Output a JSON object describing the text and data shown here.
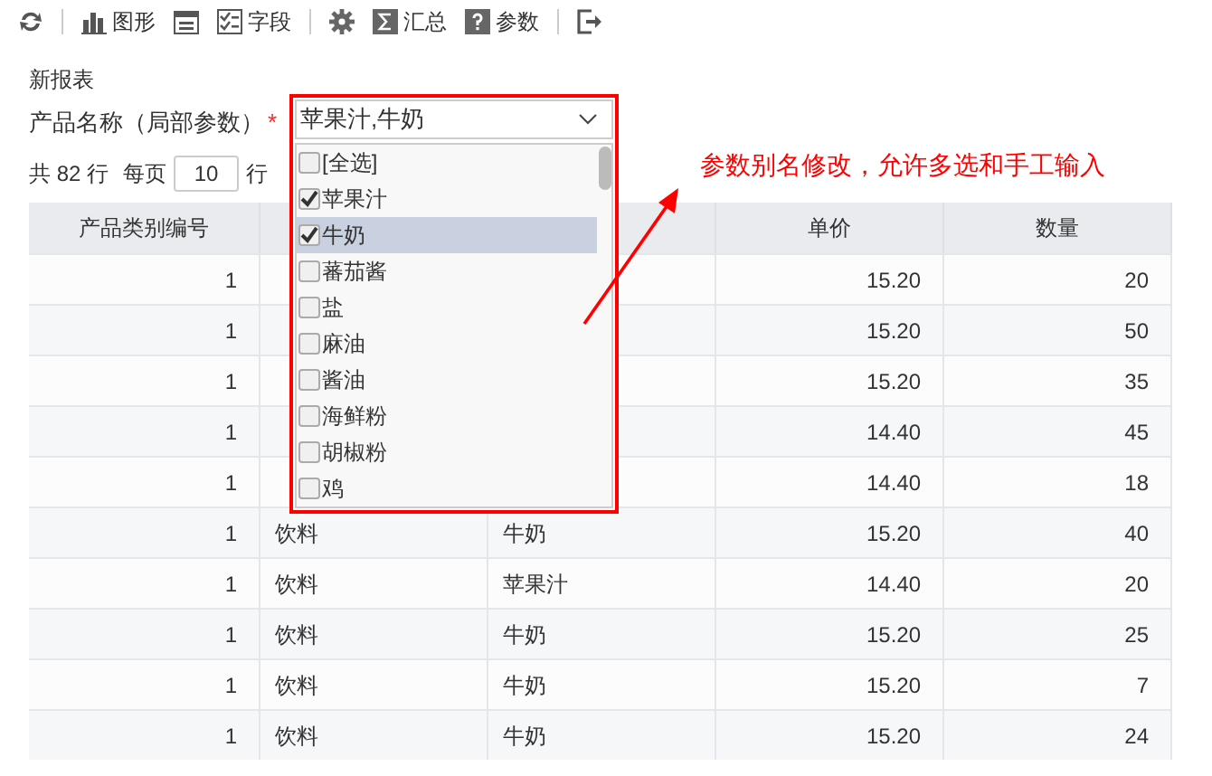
{
  "toolbar": [
    {
      "kind": "refresh"
    },
    {
      "kind": "separator"
    },
    {
      "kind": "chart",
      "label": "图形"
    },
    {
      "kind": "layout"
    },
    {
      "kind": "fields",
      "label": "字段"
    },
    {
      "kind": "separator"
    },
    {
      "kind": "settings"
    },
    {
      "kind": "sum",
      "label": "汇总"
    },
    {
      "kind": "help",
      "label": "参数"
    },
    {
      "kind": "separator"
    },
    {
      "kind": "exit"
    }
  ],
  "report_title": "新报表",
  "parameter": {
    "label": "产品名称（局部参数）",
    "required_mark": "*",
    "value": "苹果汁,牛奶",
    "options": [
      {
        "label": "[全选]",
        "checked": false,
        "selected": false
      },
      {
        "label": "苹果汁",
        "checked": true,
        "selected": false
      },
      {
        "label": "牛奶",
        "checked": true,
        "selected": true
      },
      {
        "label": "蕃茄酱",
        "checked": false,
        "selected": false
      },
      {
        "label": "盐",
        "checked": false,
        "selected": false
      },
      {
        "label": "麻油",
        "checked": false,
        "selected": false
      },
      {
        "label": "酱油",
        "checked": false,
        "selected": false
      },
      {
        "label": "海鲜粉",
        "checked": false,
        "selected": false
      },
      {
        "label": "胡椒粉",
        "checked": false,
        "selected": false
      },
      {
        "label": "鸡",
        "checked": false,
        "selected": false
      }
    ]
  },
  "pager": {
    "total": "共 82 行",
    "per_page_label": "每页",
    "per_page": "10",
    "unit": "行"
  },
  "annotation": {
    "text": "参数别名修改，允许多选和手工输入"
  },
  "table": {
    "columns": [
      "产品类别编号",
      null,
      null,
      "单价",
      "数量"
    ],
    "rows": [
      [
        "1",
        null,
        null,
        "15.20",
        "20"
      ],
      [
        "1",
        null,
        null,
        "15.20",
        "50"
      ],
      [
        "1",
        null,
        null,
        "15.20",
        "35"
      ],
      [
        "1",
        null,
        null,
        "14.40",
        "45"
      ],
      [
        "1",
        null,
        null,
        "14.40",
        "18"
      ],
      [
        "1",
        "饮料",
        "牛奶",
        "15.20",
        "40"
      ],
      [
        "1",
        "饮料",
        "苹果汁",
        "14.40",
        "20"
      ],
      [
        "1",
        "饮料",
        "牛奶",
        "15.20",
        "25"
      ],
      [
        "1",
        "饮料",
        "牛奶",
        "15.20",
        "7"
      ],
      [
        "1",
        "饮料",
        "牛奶",
        "15.20",
        "24"
      ]
    ]
  }
}
